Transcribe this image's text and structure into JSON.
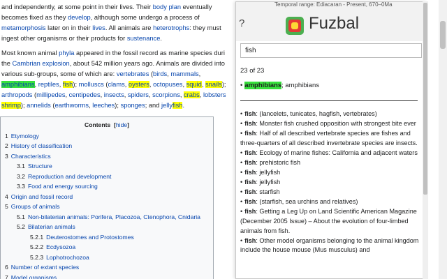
{
  "article": {
    "p1": [
      [
        {
          "t": "and independently, at some point in their lives. Their "
        },
        {
          "t": "body plan",
          "c": "lk"
        },
        {
          "t": " eventually"
        }
      ],
      [
        {
          "t": "becomes fixed as they "
        },
        {
          "t": "develop",
          "c": "lk"
        },
        {
          "t": ", although some undergo a process of"
        }
      ],
      [
        {
          "t": "metamorphosis",
          "c": "lk"
        },
        {
          "t": " later on in their "
        },
        {
          "t": "lives",
          "c": "lk"
        },
        {
          "t": ". All animals are "
        },
        {
          "t": "heterotrophs",
          "c": "lk"
        },
        {
          "t": ": they must"
        }
      ],
      [
        {
          "t": "ingest other organisms or their products for "
        },
        {
          "t": "sustenance",
          "c": "lk"
        },
        {
          "t": "."
        }
      ]
    ],
    "p2": [
      [
        {
          "t": "Most known animal "
        },
        {
          "t": "phyla",
          "c": "lk"
        },
        {
          "t": " appeared in the fossil record as marine species duri"
        }
      ],
      [
        {
          "t": "the "
        },
        {
          "t": "Cambrian explosion",
          "c": "lk"
        },
        {
          "t": ", about 542 million years ago. Animals are divided into"
        }
      ],
      [
        {
          "t": "various sub-groups, some of which are: "
        },
        {
          "t": "vertebrates",
          "c": "lk"
        },
        {
          "t": " ("
        },
        {
          "t": "birds",
          "c": "lk"
        },
        {
          "t": ", "
        },
        {
          "t": "mammals",
          "c": "lk"
        },
        {
          "t": ","
        }
      ],
      [
        {
          "t": "amphibians",
          "c": "lk hlg"
        },
        {
          "t": ", "
        },
        {
          "t": "reptiles",
          "c": "lk"
        },
        {
          "t": ", "
        },
        {
          "t": "fish",
          "c": "lk hl"
        },
        {
          "t": "); "
        },
        {
          "t": "molluscs",
          "c": "lk"
        },
        {
          "t": " ("
        },
        {
          "t": "clams",
          "c": "lk"
        },
        {
          "t": ", "
        },
        {
          "t": "oysters",
          "c": "lk hl"
        },
        {
          "t": ", "
        },
        {
          "t": "octopuses",
          "c": "lk"
        },
        {
          "t": ", "
        },
        {
          "t": "squid",
          "c": "lk hl"
        },
        {
          "t": ", "
        },
        {
          "t": "snails",
          "c": "lk hl"
        },
        {
          "t": ");"
        }
      ],
      [
        {
          "t": "arthropods",
          "c": "lk"
        },
        {
          "t": " ("
        },
        {
          "t": "millipedes",
          "c": "lk"
        },
        {
          "t": ", "
        },
        {
          "t": "centipedes",
          "c": "lk"
        },
        {
          "t": ", "
        },
        {
          "t": "insects",
          "c": "lk"
        },
        {
          "t": ", "
        },
        {
          "t": "spiders",
          "c": "lk"
        },
        {
          "t": ", "
        },
        {
          "t": "scorpions",
          "c": "lk"
        },
        {
          "t": ", "
        },
        {
          "t": "crabs",
          "c": "lk hl"
        },
        {
          "t": ", "
        },
        {
          "t": "lobsters",
          "c": "lk"
        }
      ],
      [
        {
          "t": "shrimp",
          "c": "lk hl"
        },
        {
          "t": "); "
        },
        {
          "t": "annelids",
          "c": "lk"
        },
        {
          "t": " ("
        },
        {
          "t": "earthworms",
          "c": "lk"
        },
        {
          "t": ", "
        },
        {
          "t": "leeches",
          "c": "lk"
        },
        {
          "t": "); "
        },
        {
          "t": "sponges",
          "c": "lk"
        },
        {
          "t": "; and "
        },
        {
          "t": "jelly",
          "c": "lk"
        },
        {
          "t": "fish",
          "c": "lk hl"
        },
        {
          "t": "."
        }
      ]
    ]
  },
  "toc": {
    "title": "Contents",
    "hide_label": "hide",
    "items": [
      {
        "n": "1",
        "label": "Etymology",
        "level": 1
      },
      {
        "n": "2",
        "label": "History of classification",
        "level": 1
      },
      {
        "n": "3",
        "label": "Characteristics",
        "level": 1
      },
      {
        "n": "3.1",
        "label": "Structure",
        "level": 2
      },
      {
        "n": "3.2",
        "label": "Reproduction and development",
        "level": 2
      },
      {
        "n": "3.3",
        "label": "Food and energy sourcing",
        "level": 2
      },
      {
        "n": "4",
        "label": "Origin and fossil record",
        "level": 1
      },
      {
        "n": "5",
        "label": "Groups of animals",
        "level": 1
      },
      {
        "n": "5.1",
        "label": "Non-bilaterian animals: Porifera, Placozoa, Ctenophora, Cnidaria",
        "level": 2
      },
      {
        "n": "5.2",
        "label": "Bilaterian animals",
        "level": 2
      },
      {
        "n": "5.2.1",
        "label": "Deuterostomes and Protostomes",
        "level": 3
      },
      {
        "n": "5.2.2",
        "label": "Ecdysozoa",
        "level": 3
      },
      {
        "n": "5.2.3",
        "label": "Lophotrochozoa",
        "level": 3
      },
      {
        "n": "6",
        "label": "Number of extant species",
        "level": 1
      },
      {
        "n": "7",
        "label": "Model organisms",
        "level": 1
      }
    ]
  },
  "popup": {
    "help_label": "?",
    "brand": "Fuzbal",
    "peek_text": "Temporal range: Ediacaran - Present, 670–0Ma",
    "search_value": "fish",
    "results_count": "23 of 23",
    "top_result": {
      "term": "amphibians",
      "rest": "; amphibians"
    },
    "results": [
      {
        "term": "fish",
        "rest": ": (lancelets, tunicates, hagfish, vertebrates)"
      },
      {
        "term": "fish",
        "rest": ": Monster fish crushed opposition with strongest bite ever"
      },
      {
        "term": "fish",
        "rest": ": Half of all described vertebrate species are fishes and three-quarters of all described invertebrate species are insects."
      },
      {
        "term": "fish",
        "rest": ": Ecology of marine fishes: California and adjacent waters"
      },
      {
        "term": "fish",
        "rest": ": prehistoric fish"
      },
      {
        "term": "fish",
        "rest": ": jellyfish"
      },
      {
        "term": "fish",
        "rest": ": jellyfish"
      },
      {
        "term": "fish",
        "rest": ": starfish"
      },
      {
        "term": "fish",
        "rest": ": (starfish, sea urchins and relatives)"
      },
      {
        "term": "fish",
        "rest": ": Getting a Leg Up on Land Scientific American Magazine (December 2005 Issue) – About the evolution of four-limbed animals from fish."
      },
      {
        "term": "fish",
        "rest": ": Other model organisms belonging to the animal kingdom include the house mouse (Mus musculus) and"
      }
    ]
  },
  "colors": {
    "link": "#0645ad",
    "highlight": "#ffff00",
    "highlight_current": "#37e13c",
    "logo_green": "#4caf50",
    "logo_red": "#e53935",
    "logo_yellow": "#fdd835"
  },
  "icons": {
    "logo": "fuzbal-logo-icon"
  }
}
